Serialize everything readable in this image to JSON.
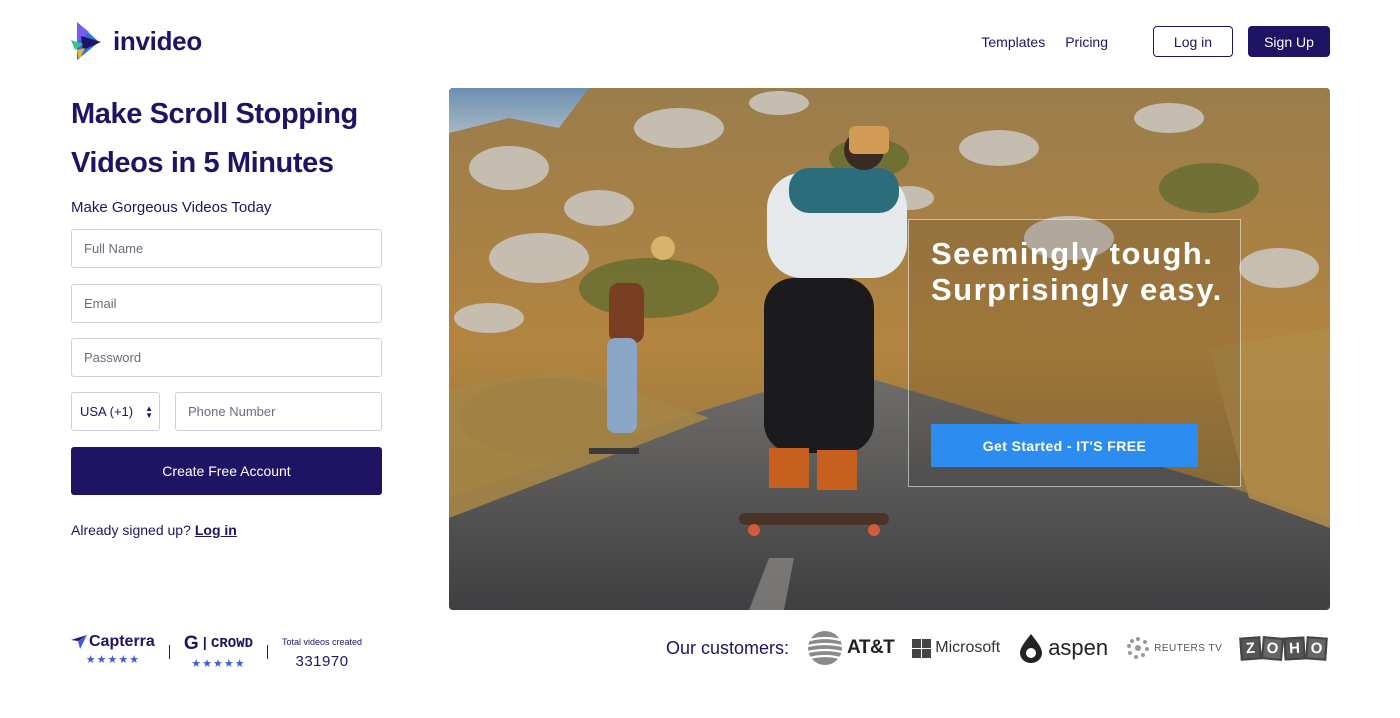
{
  "brand": {
    "name": "invideo"
  },
  "nav": {
    "templates": "Templates",
    "pricing": "Pricing",
    "login": "Log in",
    "signup": "Sign Up"
  },
  "form": {
    "headline": "Make Scroll Stopping Videos in 5 Minutes",
    "subhead": "Make Gorgeous Videos Today",
    "full_name_placeholder": "Full Name",
    "email_placeholder": "Email",
    "password_placeholder": "Password",
    "country_code": "USA (+1)",
    "phone_placeholder": "Phone Number",
    "submit_label": "Create Free Account",
    "already_text": "Already signed up?",
    "login_link": "Log in"
  },
  "hero": {
    "overlay_text": "Seemingly tough. Surprisingly easy.",
    "cta_label": "Get Started - IT'S FREE"
  },
  "badges": {
    "capterra": "Capterra",
    "capterra_stars": "★★★★★",
    "g2": "CROWD",
    "g2_stars": "★★★★★",
    "total_label": "Total videos created",
    "total_value": "331970"
  },
  "customers": {
    "label": "Our customers:",
    "att": "AT&T",
    "microsoft": "Microsoft",
    "aspen": "aspen",
    "reuters": "REUTERS TV",
    "zoho": [
      "Z",
      "O",
      "H",
      "O"
    ]
  },
  "colors": {
    "brand_navy": "#1e1463",
    "cta_blue": "#2d8cf0"
  }
}
